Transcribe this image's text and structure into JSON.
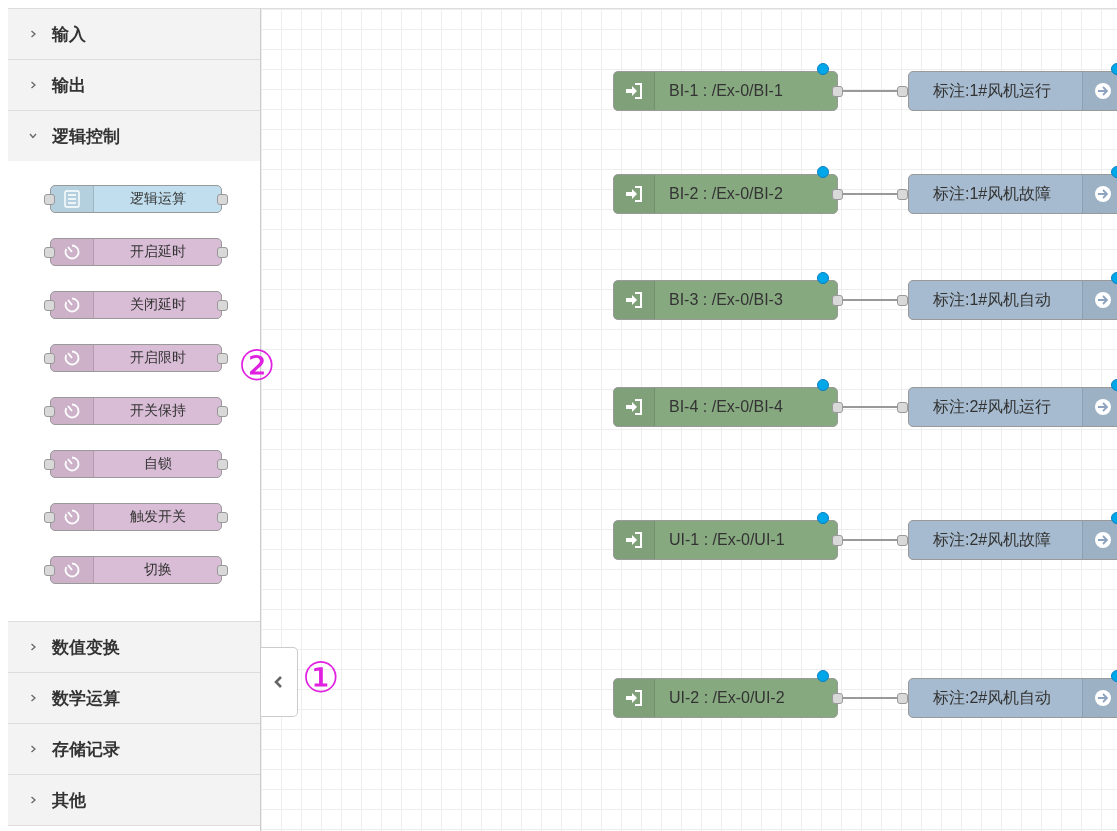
{
  "palette": {
    "categories": [
      {
        "label": "输入",
        "expanded": false
      },
      {
        "label": "输出",
        "expanded": false
      },
      {
        "label": "逻辑控制",
        "expanded": true,
        "nodes": [
          {
            "label": "逻辑运算",
            "kind": "logic"
          },
          {
            "label": "开启延时",
            "kind": "timer"
          },
          {
            "label": "关闭延时",
            "kind": "timer"
          },
          {
            "label": "开启限时",
            "kind": "timer"
          },
          {
            "label": "开关保持",
            "kind": "timer"
          },
          {
            "label": "自锁",
            "kind": "timer"
          },
          {
            "label": "触发开关",
            "kind": "timer"
          },
          {
            "label": "切换",
            "kind": "timer"
          }
        ]
      },
      {
        "label": "数值变换",
        "expanded": false
      },
      {
        "label": "数学运算",
        "expanded": false
      },
      {
        "label": "存储记录",
        "expanded": false
      },
      {
        "label": "其他",
        "expanded": false
      }
    ]
  },
  "annotations": [
    {
      "label": "②"
    },
    {
      "label": "①"
    }
  ],
  "flows": [
    {
      "source": {
        "label": "BI-1 : /Ex-0/BI-1",
        "changed": true
      },
      "target": {
        "label": "标注:1#风机运行",
        "changed": true
      }
    },
    {
      "source": {
        "label": "BI-2 : /Ex-0/BI-2",
        "changed": true
      },
      "target": {
        "label": "标注:1#风机故障",
        "changed": true
      }
    },
    {
      "source": {
        "label": "BI-3 : /Ex-0/BI-3",
        "changed": true
      },
      "target": {
        "label": "标注:1#风机自动",
        "changed": true
      }
    },
    {
      "source": {
        "label": "BI-4 : /Ex-0/BI-4",
        "changed": true
      },
      "target": {
        "label": "标注:2#风机运行",
        "changed": true
      }
    },
    {
      "source": {
        "label": "UI-1 : /Ex-0/UI-1",
        "changed": true
      },
      "target": {
        "label": "标注:2#风机故障",
        "changed": true
      }
    },
    {
      "source": {
        "label": "UI-2 : /Ex-0/UI-2",
        "changed": true
      },
      "target": {
        "label": "标注:2#风机自动",
        "changed": true
      }
    }
  ]
}
